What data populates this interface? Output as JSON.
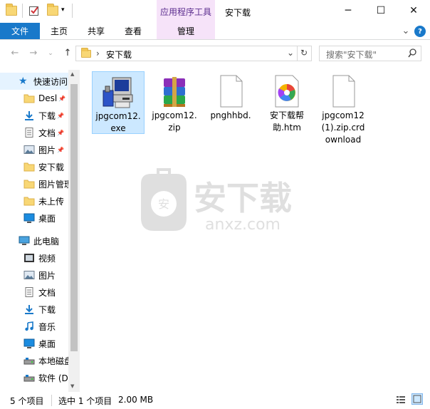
{
  "window": {
    "title": "安下载"
  },
  "titlebar": {
    "contextual_tab_group": "应用程序工具",
    "buttons": {
      "minimize": "─",
      "maximize": "☐",
      "close": "✕"
    }
  },
  "ribbon": {
    "tabs": [
      "文件",
      "主页",
      "共享",
      "查看",
      "管理"
    ],
    "collapse_glyph": "⌄",
    "help_glyph": "?"
  },
  "address": {
    "path_separator": "›",
    "path": "安下载",
    "dropdown_glyph": "⌄",
    "refresh_glyph": "↻"
  },
  "search": {
    "placeholder": "搜索\"安下载\"",
    "icon": "search-icon"
  },
  "nav": {
    "quick_access": "快速访问",
    "quick_items": [
      {
        "label": "Desl",
        "pinned": true,
        "icon": "folder-icon"
      },
      {
        "label": "下载",
        "pinned": true,
        "icon": "download-icon"
      },
      {
        "label": "文档",
        "pinned": true,
        "icon": "document-icon"
      },
      {
        "label": "图片",
        "pinned": true,
        "icon": "picture-icon"
      },
      {
        "label": "安下载",
        "pinned": false,
        "icon": "folder-icon"
      },
      {
        "label": "图片管理",
        "pinned": false,
        "icon": "folder-icon"
      },
      {
        "label": "未上传",
        "pinned": false,
        "icon": "folder-icon"
      },
      {
        "label": "桌面",
        "pinned": false,
        "icon": "desktop-icon"
      }
    ],
    "this_pc": "此电脑",
    "pc_items": [
      {
        "label": "视频",
        "icon": "video-icon"
      },
      {
        "label": "图片",
        "icon": "picture-icon"
      },
      {
        "label": "文档",
        "icon": "document-icon"
      },
      {
        "label": "下载",
        "icon": "download-icon"
      },
      {
        "label": "音乐",
        "icon": "music-icon"
      },
      {
        "label": "桌面",
        "icon": "desktop-icon"
      },
      {
        "label": "本地磁盘",
        "icon": "drive-icon"
      },
      {
        "label": "软件 (D",
        "icon": "drive-icon"
      }
    ]
  },
  "files": [
    {
      "name": "jpgcom12.exe",
      "lines": [
        "jpgcom12.",
        "exe"
      ],
      "icon": "installer-exe-icon",
      "selected": true
    },
    {
      "name": "jpgcom12.zip",
      "lines": [
        "jpgcom12.",
        "zip"
      ],
      "icon": "winrar-archive-icon",
      "selected": false
    },
    {
      "name": "pnghhbd.",
      "lines": [
        "pnghhbd."
      ],
      "icon": "blank-file-icon",
      "selected": false
    },
    {
      "name": "安下载帮助.htm",
      "lines": [
        "安下载帮",
        "助.htm"
      ],
      "icon": "browser-htm-icon",
      "selected": false
    },
    {
      "name": "jpgcom12 (1).zip.crdownload",
      "lines": [
        "jpgcom12",
        "(1).zip.crd",
        "ownload"
      ],
      "icon": "blank-file-icon",
      "selected": false
    }
  ],
  "watermark": {
    "text": "安下载",
    "subtext": "anxz.com"
  },
  "status": {
    "item_count": "5 个项目",
    "selection": "选中 1 个项目",
    "size": "2.00 MB"
  },
  "colors": {
    "file_tab": "#1979ca",
    "selection": "#cce8ff",
    "contextual": "#f6e3f9",
    "nav_highlight": "#e5f3ff"
  }
}
